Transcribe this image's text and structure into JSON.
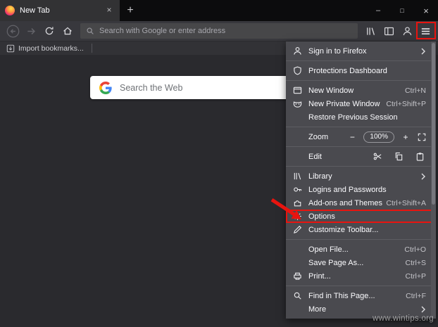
{
  "titlebar": {
    "tab_title": "New Tab",
    "tab_close": "×",
    "new_tab_button": "+",
    "minimize": "–",
    "maximize": "□",
    "close": "×"
  },
  "navbar": {
    "url_placeholder": "Search with Google or enter address"
  },
  "bookmarks_bar": {
    "import_label": "Import bookmarks..."
  },
  "content": {
    "search_placeholder": "Search the Web",
    "watermark": "www.wintips.org"
  },
  "menu": {
    "items": [
      {
        "id": "sign-in-to-firefox",
        "label": "Sign in to Firefox",
        "icon": "person",
        "chevron": true
      },
      {
        "type": "separator"
      },
      {
        "id": "protections-dashboard",
        "label": "Protections Dashboard",
        "icon": "shield"
      },
      {
        "type": "separator"
      },
      {
        "id": "new-window",
        "label": "New Window",
        "icon": "window",
        "shortcut": "Ctrl+N"
      },
      {
        "id": "new-private-window",
        "label": "New Private Window",
        "icon": "mask",
        "shortcut": "Ctrl+Shift+P"
      },
      {
        "id": "restore-previous-session",
        "label": "Restore Previous Session"
      },
      {
        "type": "separator"
      },
      {
        "type": "zoom",
        "id": "zoom",
        "label": "Zoom",
        "zoom_out": "−",
        "zoom_value": "100%",
        "zoom_in": "+"
      },
      {
        "type": "separator"
      },
      {
        "type": "edit",
        "id": "edit",
        "label": "Edit"
      },
      {
        "type": "separator"
      },
      {
        "id": "library",
        "label": "Library",
        "icon": "library",
        "chevron": true
      },
      {
        "id": "logins-and-passwords",
        "label": "Logins and Passwords",
        "icon": "key"
      },
      {
        "id": "add-ons-and-themes",
        "label": "Add-ons and Themes",
        "icon": "puzzle",
        "shortcut": "Ctrl+Shift+A"
      },
      {
        "id": "options",
        "label": "Options",
        "icon": "gear",
        "highlight": true
      },
      {
        "id": "customize-toolbar",
        "label": "Customize Toolbar...",
        "icon": "pencil"
      },
      {
        "type": "separator"
      },
      {
        "id": "open-file",
        "label": "Open File...",
        "shortcut": "Ctrl+O"
      },
      {
        "id": "save-page-as",
        "label": "Save Page As...",
        "shortcut": "Ctrl+S"
      },
      {
        "id": "print",
        "label": "Print...",
        "icon": "printer",
        "shortcut": "Ctrl+P"
      },
      {
        "type": "separator"
      },
      {
        "id": "find-in-this-page",
        "label": "Find in This Page...",
        "icon": "magnifier",
        "shortcut": "Ctrl+F"
      },
      {
        "id": "more",
        "label": "More",
        "chevron": true
      }
    ]
  },
  "colors": {
    "annotation_red": "#e8140f",
    "menu_background": "#4a4a4f",
    "toolbar_background": "#38383d",
    "titlebar_background": "#0c0c0d",
    "content_background": "#2a2a2e",
    "searchbox_background": "#ffffff"
  }
}
